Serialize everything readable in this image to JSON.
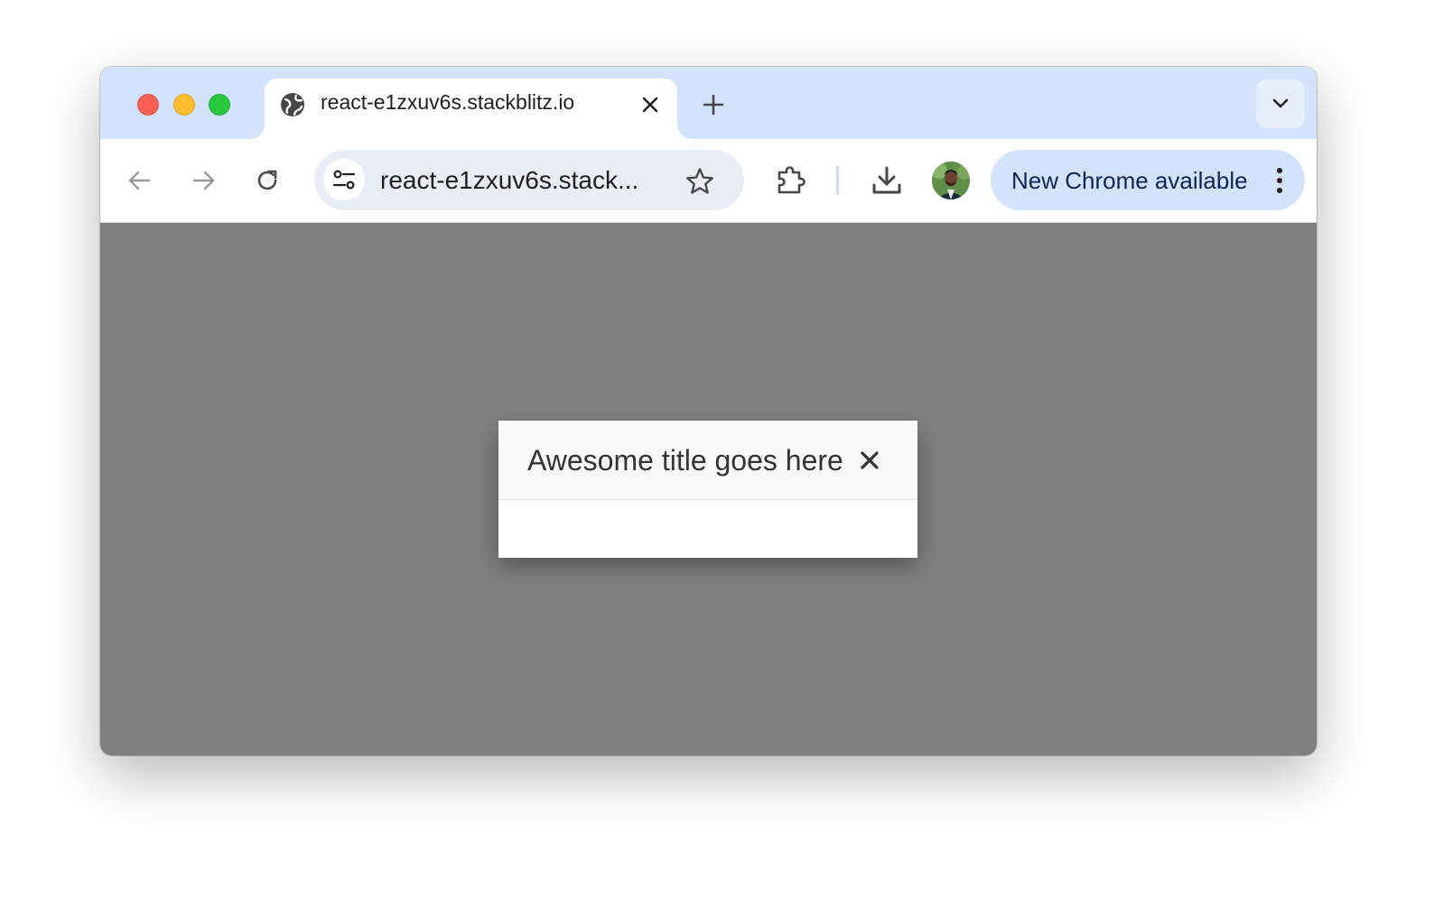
{
  "browser": {
    "tab": {
      "title": "react-e1zxuv6s.stackblitz.io"
    },
    "omnibox": {
      "url_display": "react-e1zxuv6s.stack..."
    },
    "update_chip": {
      "label": "New Chrome available"
    },
    "colors": {
      "tabstrip": "#d3e3fd",
      "chip": "#d3e3fd",
      "omnibox": "#e9eef6"
    }
  },
  "page": {
    "backdrop_color": "#808080",
    "dialog": {
      "title": "Awesome title goes here"
    }
  }
}
